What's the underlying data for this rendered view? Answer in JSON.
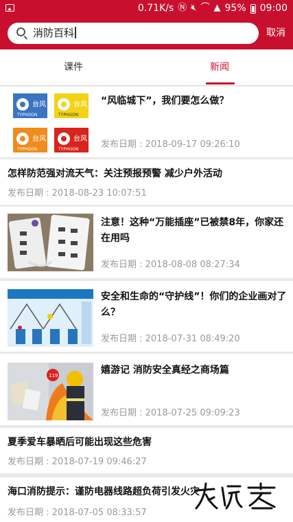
{
  "status_bar": {
    "speed": "0.71K/s",
    "battery": "95%",
    "time": "09:00"
  },
  "search": {
    "query": "消防百科",
    "cancel_label": "取消"
  },
  "tabs": [
    {
      "label": "课件"
    },
    {
      "label": "新闻"
    }
  ],
  "news": [
    {
      "title": "“风临城下”，我们要怎么做？",
      "date": "发布日期 : 2018-09-17 09:26:10"
    },
    {
      "title": "怎样防范强对流天气：关注预报预警 减少户外活动",
      "date": "发布日期 : 2018-08-23 10:07:51"
    },
    {
      "title": "注意！这种“万能插座”已被禁8年，你家还在用吗",
      "date": "发布日期 : 2018-08-08 08:27:34"
    },
    {
      "title": "安全和生命的“守护线”！你们的企业画对了么？",
      "date": "发布日期 : 2018-07-31 08:49:20"
    },
    {
      "title": "嬉游记 消防安全真经之商场篇",
      "date": "发布日期 : 2018-07-25 09:09:23"
    },
    {
      "title": "夏季爱车暴晒后可能出现这些危害",
      "date": "发布日期 : 2018-07-19 09:46:27"
    },
    {
      "title": "海口消防提示：谨防电器线路超负荷引发火灾",
      "date": "发布日期 : 2018-07-05 08:33:57"
    }
  ],
  "thumb_texts": {
    "typhoon_a": "台风",
    "typhoon_b": "TYPHOON",
    "badge": "119"
  },
  "colors": {
    "brand_red": "#c8102e",
    "date_gray": "#9a9a9a"
  }
}
